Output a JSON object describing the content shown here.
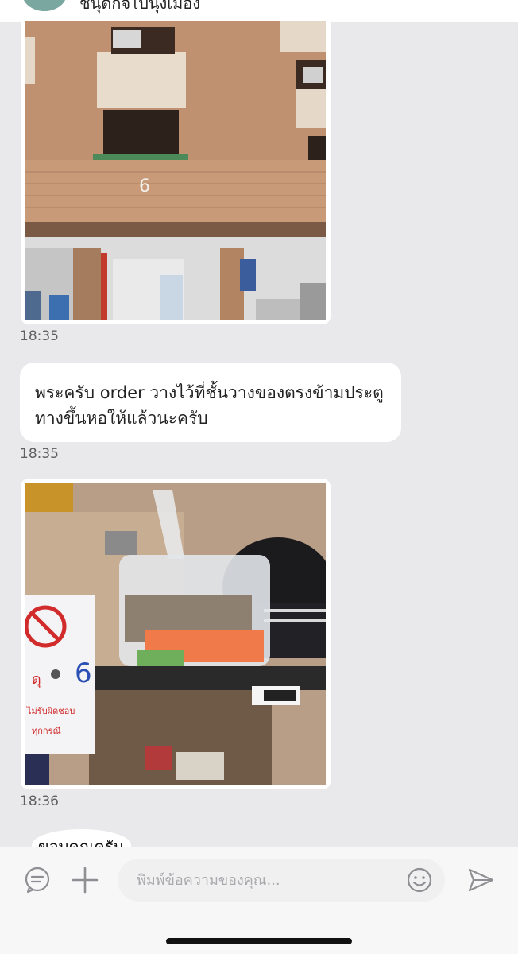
{
  "header": {
    "contact_name": "ชนุดกิจไปนุ่งเมือง"
  },
  "messages": [
    {
      "type": "image",
      "alt": "",
      "time": "18:35"
    },
    {
      "type": "text",
      "text": "พระครับ order วางไว้ที่ชั้นวางของตรงข้ามประตูทางขึ้นหอให้แล้วนะครับ",
      "time": "18:35"
    },
    {
      "type": "image",
      "alt": "",
      "time": "18:36"
    }
  ],
  "sticker": {
    "text": "ขอบคุณครับ"
  },
  "photo2_labels": {
    "sign_number": "6",
    "sign_line1": "ดุ",
    "sign_line2": "ไม่รับผิดชอบ",
    "sign_line3": "ทุกกรณี"
  },
  "photo1_labels": {
    "floor_number": "6"
  },
  "composer": {
    "placeholder": "พิมพ์ข้อความของคุณ..."
  },
  "colors": {
    "background": "#e9e9eb",
    "bubble": "#ffffff",
    "timestamp": "#5f5f5f",
    "icons": "#8e8e93"
  }
}
